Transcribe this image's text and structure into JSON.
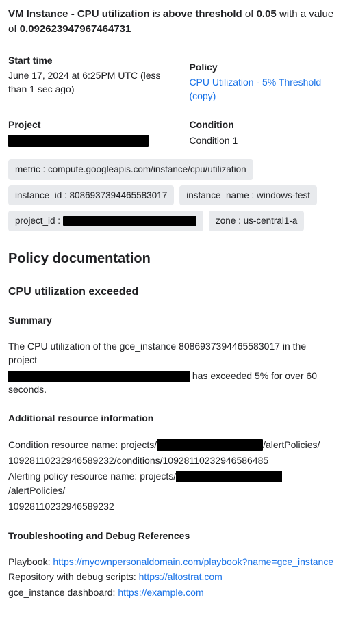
{
  "title": {
    "part1_bold": "VM Instance - CPU utilization",
    "part2": " is ",
    "part3_bold": "above threshold",
    "part4": " of ",
    "threshold_bold": "0.05",
    "part5": " with a value of ",
    "value_bold": "0.092623947967464731"
  },
  "meta": {
    "start_label": "Start time",
    "start_value": "June 17, 2024 at 6:25PM UTC (less than 1 sec ago)",
    "policy_label": "Policy",
    "policy_link": "CPU Utilization - 5% Threshold (copy)",
    "project_label": "Project",
    "condition_label": "Condition",
    "condition_value": "Condition 1"
  },
  "chips": {
    "metric": "metric : compute.googleapis.com/instance/cpu/utilization",
    "instance_id": "instance_id : 8086937394465583017",
    "instance_name": "instance_name : windows-test",
    "project_id_prefix": "project_id :",
    "zone": "zone : us-central1-a"
  },
  "doc": {
    "heading": "Policy documentation",
    "sub": "CPU utilization exceeded",
    "summary_h": "Summary",
    "summary_1": "The CPU utilization of the gce_instance 8086937394465583017 in the project",
    "summary_2": " has exceeded 5% for over 60 seconds.",
    "res_h": "Additional resource information",
    "res_cond_a": "Condition resource name: projects/",
    "res_cond_b": "/alertPolicies/",
    "res_cond_c": "10928110232946589232/conditions/10928110232946586485",
    "res_pol_a": "Alerting policy resource name: projects/",
    "res_pol_b": "/alertPolicies/",
    "res_pol_c": "10928110232946589232",
    "trouble_h": "Troubleshooting and Debug References",
    "playbook_label": "Playbook: ",
    "playbook_link": "https://myownpersonaldomain.com/playbook?name=gce_instance",
    "repo_label": "Repository with debug scripts: ",
    "repo_link": "https://altostrat.com",
    "dash_label": "gce_instance dashboard: ",
    "dash_link": "https://example.com"
  }
}
